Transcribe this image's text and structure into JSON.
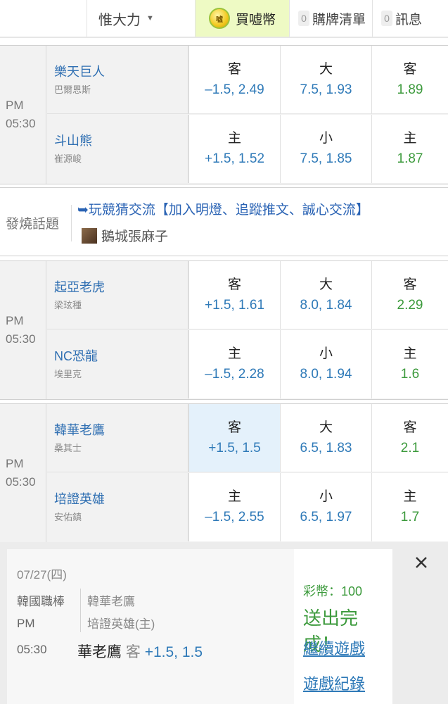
{
  "header": {
    "user": "惟大力",
    "buy_coin": "買嘘幣",
    "coin_glyph": "嘘",
    "cart_count": "0",
    "cart_label": "購牌清單",
    "msg_count": "0",
    "msg_label": "訊息"
  },
  "games": [
    {
      "time_ampm": "PM",
      "time": "05:30",
      "away": {
        "team": "樂天巨人",
        "pitcher": "巴爾恩斯",
        "spread_label": "客",
        "spread": "–1.5, 2.49",
        "total_label": "大",
        "total": "7.5, 1.93",
        "ml_label": "客",
        "ml": "1.89"
      },
      "home": {
        "team": "斗山熊",
        "pitcher": "崔源峻",
        "spread_label": "主",
        "spread": "+1.5, 1.52",
        "total_label": "小",
        "total": "7.5, 1.85",
        "ml_label": "主",
        "ml": "1.87"
      }
    },
    {
      "time_ampm": "PM",
      "time": "05:30",
      "away": {
        "team": "起亞老虎",
        "pitcher": "梁玹種",
        "spread_label": "客",
        "spread": "+1.5, 1.61",
        "total_label": "大",
        "total": "8.0, 1.84",
        "ml_label": "客",
        "ml": "2.29"
      },
      "home": {
        "team": "NC恐龍",
        "pitcher": "埃里克",
        "spread_label": "主",
        "spread": "–1.5, 2.28",
        "total_label": "小",
        "total": "8.0, 1.94",
        "ml_label": "主",
        "ml": "1.6"
      }
    },
    {
      "time_ampm": "PM",
      "time": "05:30",
      "away": {
        "team": "韓華老鷹",
        "pitcher": "桑其士",
        "spread_label": "客",
        "spread": "+1.5, 1.5",
        "total_label": "大",
        "total": "6.5, 1.83",
        "ml_label": "客",
        "ml": "2.1"
      },
      "home": {
        "team": "培證英雄",
        "pitcher": "安佑鎮",
        "spread_label": "主",
        "spread": "–1.5, 2.55",
        "total_label": "小",
        "total": "6.5, 1.97",
        "ml_label": "主",
        "ml": "1.7"
      }
    }
  ],
  "hot_topic": {
    "label": "發燒話題",
    "topic": "➥玩競猜交流【加入明燈、追蹤推文、誠心交流】",
    "author": "鵝城張麻子"
  },
  "bet_slip": {
    "date": "07/27(四)",
    "league": "韓國職棒",
    "ampm": "PM",
    "time": "05:30",
    "home_team": "韓華老鷹",
    "away_team": "培證英雄(主)",
    "pick_team": "華老鷹",
    "pick_side": "客",
    "pick_odds": "+1.5, 1.5",
    "coins": "彩幣：100",
    "status": "送出完成！",
    "continue": "繼續遊戲",
    "history": "遊戲紀錄"
  },
  "colors": {
    "team_blue": "#2f6fb2",
    "odds_blue": "#2f7ab8",
    "odds_green": "#3c9a3c",
    "selected_bg": "#e4f1fb",
    "buy_bg": "#eefac4"
  }
}
